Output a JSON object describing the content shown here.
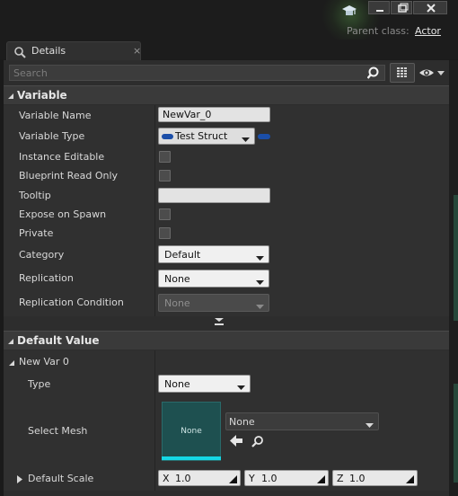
{
  "window": {
    "parent_class_label": "Parent class:",
    "parent_class_value": "Actor"
  },
  "tab": {
    "label": "Details",
    "close": "×"
  },
  "search": {
    "placeholder": "Search"
  },
  "variable_section": {
    "title": "Variable",
    "rows": {
      "name_label": "Variable Name",
      "name_value": "NewVar_0",
      "type_label": "Variable Type",
      "type_value": "Test Struct",
      "instance_editable": "Instance Editable",
      "bp_read_only": "Blueprint Read Only",
      "tooltip": "Tooltip",
      "expose_on_spawn": "Expose on Spawn",
      "private": "Private",
      "category_label": "Category",
      "category_value": "Default",
      "replication_label": "Replication",
      "replication_value": "None",
      "rep_condition_label": "Replication Condition",
      "rep_condition_value": "None"
    }
  },
  "default_section": {
    "title": "Default Value",
    "new_var_label": "New Var 0",
    "type_label": "Type",
    "type_value": "None",
    "mesh_label": "Select Mesh",
    "mesh_thumb_text": "None",
    "mesh_value": "None",
    "scale_label": "Default Scale",
    "scale": {
      "x_axis": "X",
      "x": "1.0",
      "y_axis": "Y",
      "y": "1.0",
      "z_axis": "Z",
      "z": "1.0"
    }
  },
  "colors": {
    "panel": "#2d2d2d",
    "header": "#3a3a3a",
    "accent_cyan": "#15d8e6",
    "pin_blue": "#1b4ea8"
  }
}
